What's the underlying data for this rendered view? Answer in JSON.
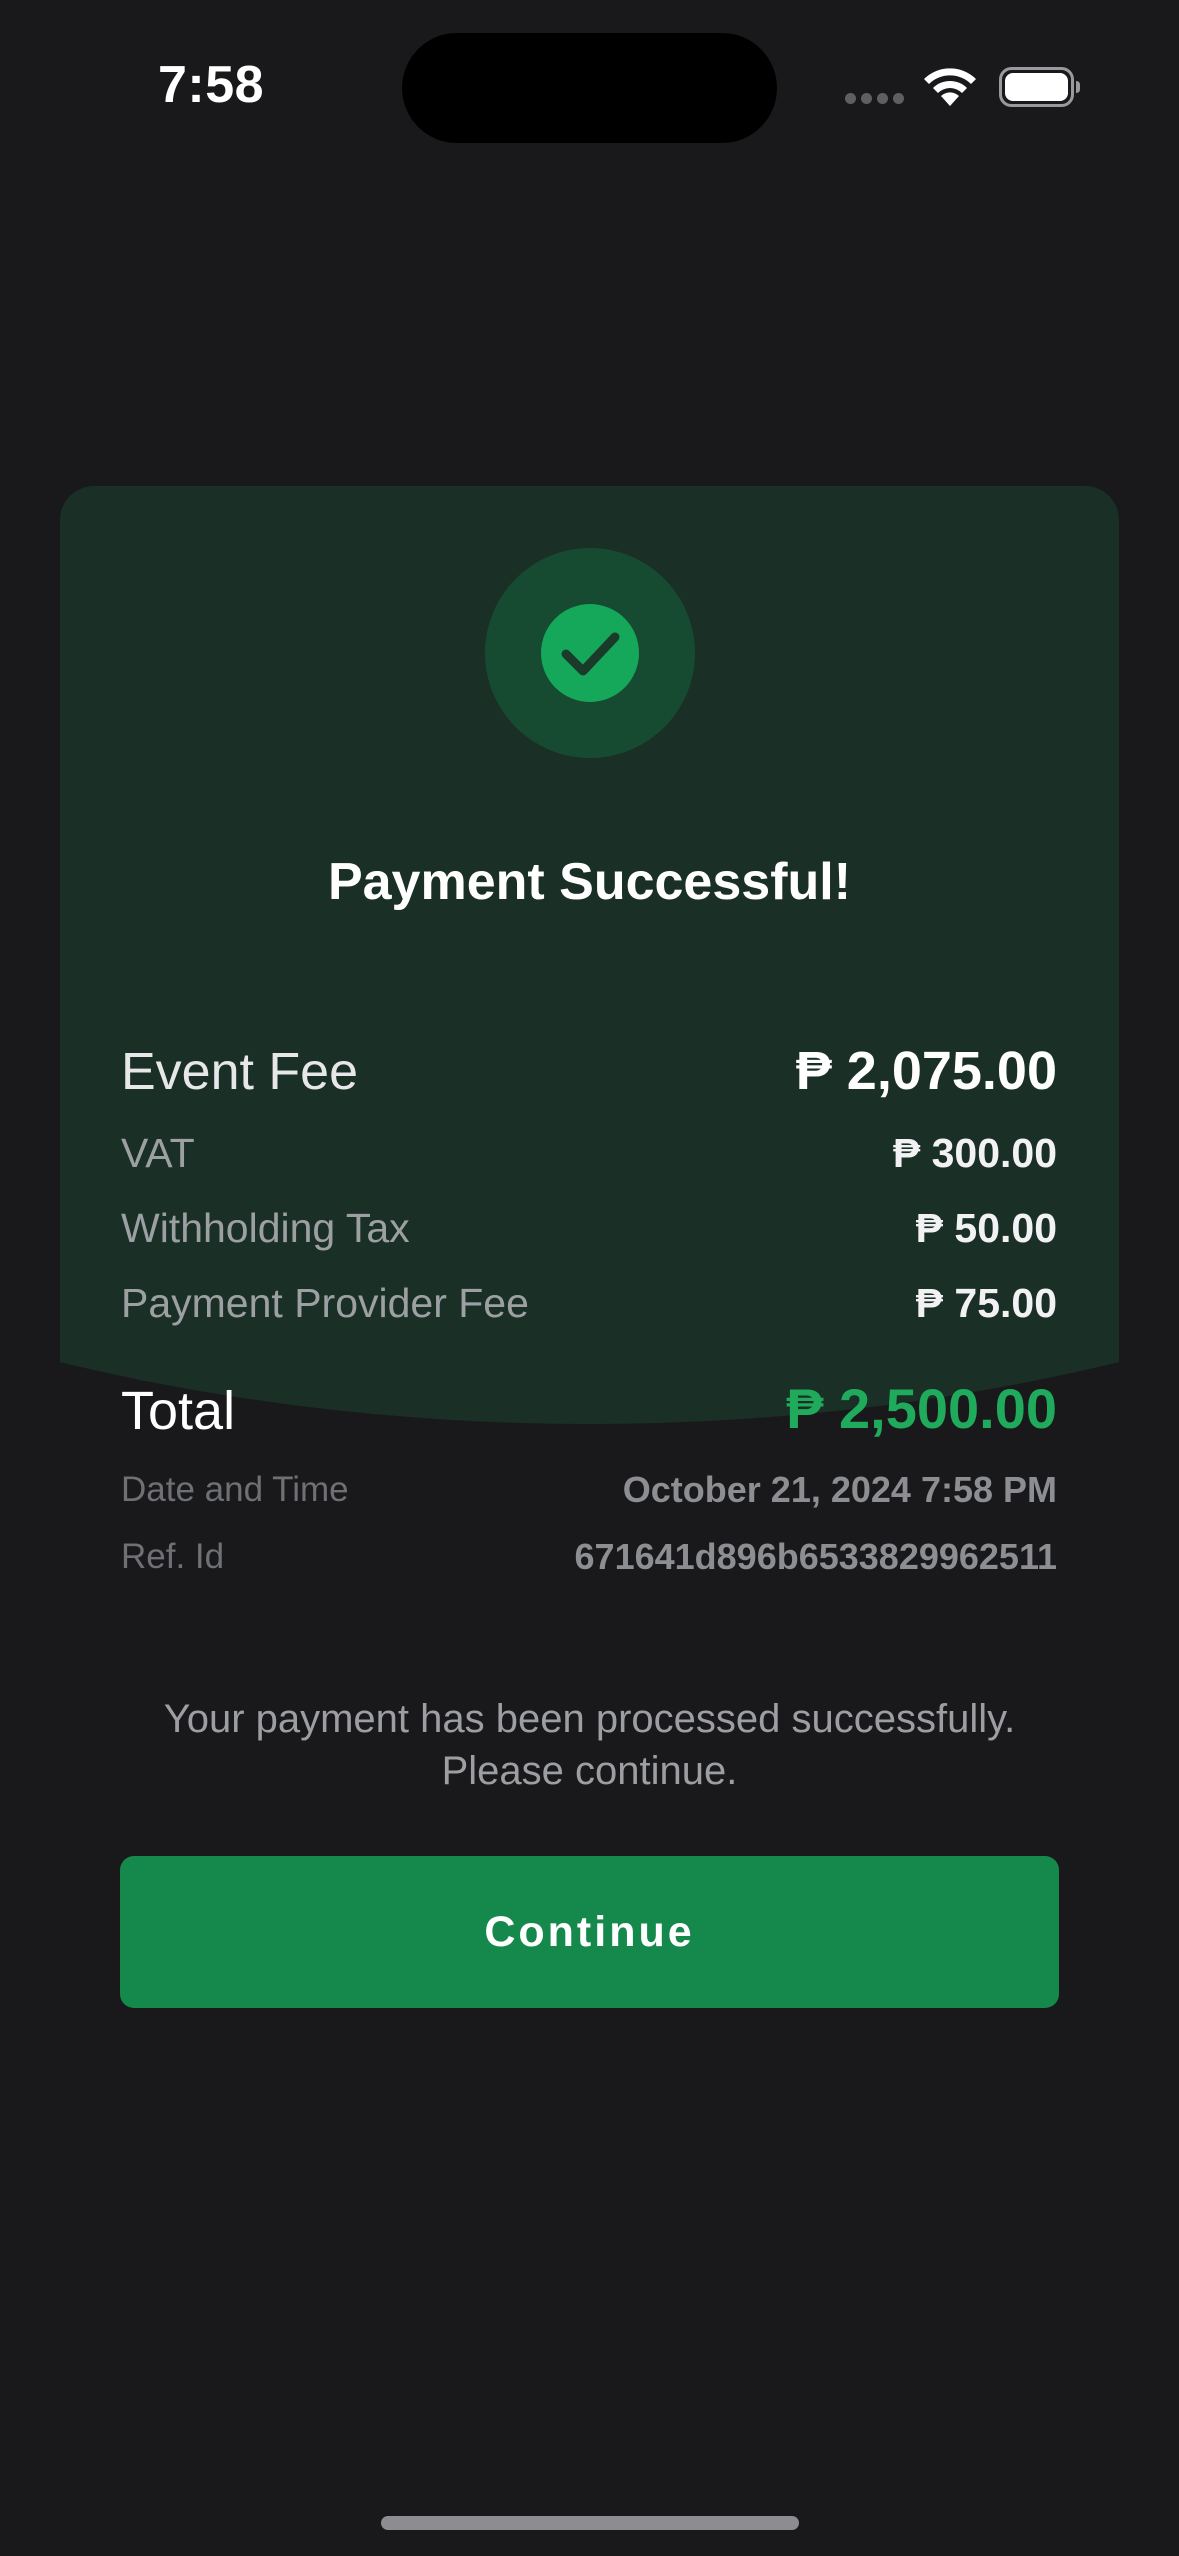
{
  "status_bar": {
    "time": "7:58"
  },
  "receipt": {
    "title": "Payment Successful!",
    "event_fee": {
      "label": "Event Fee",
      "value": "₱ 2,075.00"
    },
    "vat": {
      "label": "VAT",
      "value": "₱ 300.00"
    },
    "withholding_tax": {
      "label": "Withholding Tax",
      "value": "₱ 50.00"
    },
    "provider_fee": {
      "label": "Payment Provider Fee",
      "value": "₱ 75.00"
    },
    "total": {
      "label": "Total",
      "value": "₱ 2,500.00"
    },
    "date_time": {
      "label": "Date and Time",
      "value": "October 21, 2024 7:58 PM"
    },
    "ref_id": {
      "label": "Ref. Id",
      "value": "671641d896b6533829962511"
    }
  },
  "message": {
    "line1": "Your payment has been processed successfully.",
    "line2": "Please continue."
  },
  "actions": {
    "continue_label": "Continue"
  },
  "colors": {
    "background": "#19191b",
    "card": "#1a2f25",
    "accent_green": "#1faa5c",
    "button_green": "#14894b"
  },
  "icons": {
    "success": "checkmark-circle-icon",
    "wifi": "wifi-icon",
    "battery": "battery-icon",
    "signal": "signal-dots-icon"
  }
}
